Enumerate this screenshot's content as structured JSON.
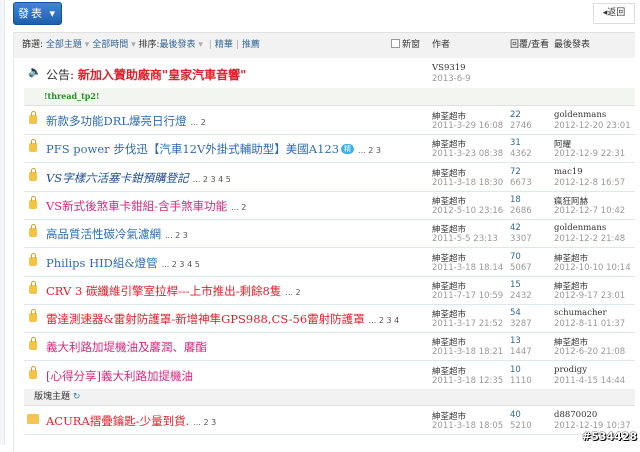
{
  "toolbar": {
    "post_label": "發表",
    "back_label": "返回"
  },
  "filter": {
    "label": "篩選:",
    "all_topics": "全部主題",
    "all_time": "全部時間",
    "sort_label": "排序:",
    "sort_value": "最後發表",
    "digest": "精華",
    "recommend": "推薦",
    "new_window": "新窗",
    "col_author": "作者",
    "col_replies": "回覆/查看",
    "col_last": "最後發表"
  },
  "announcement": {
    "prefix": "公告:",
    "title": "新加入贊助廠商\"皇家汽車音響\"",
    "author": "VS9319",
    "date": "2013-6-9"
  },
  "thread_tp": "!thread_tp2!",
  "threads": [
    {
      "title": "新款多功能DRL爆亮日行燈",
      "color": "blue",
      "pages": "... 2",
      "author": "紳荃超市",
      "date": "2011-3-29 16:08",
      "replies": "22",
      "views": "2746",
      "last_user": "goldenmans",
      "last_date": "2012-12-20 23:01"
    },
    {
      "title": "PFS power 步伐迅【汽車12V外掛式輔助型】美國A123",
      "color": "blue",
      "badge": "精",
      "pages": "... 2 3",
      "author": "紳荃超市",
      "date": "2011-3-23 08:38",
      "replies": "31",
      "views": "4362",
      "last_user": "阿耀",
      "last_date": "2012-12-9 22:31"
    },
    {
      "title": "VS字樣六活塞卡鉗預購登記",
      "color": "navy",
      "pages": "... 2 3 4 5",
      "author": "紳荃超市",
      "date": "2011-3-18 18:30",
      "replies": "72",
      "views": "6673",
      "last_user": "mac19",
      "last_date": "2012-12-8 16:57"
    },
    {
      "title": "VS新式後煞車卡鉗組-含手煞車功能",
      "color": "pink",
      "pages": "... 2",
      "author": "紳荃超市",
      "date": "2012-5-10 23:16",
      "replies": "18",
      "views": "2686",
      "last_user": "瘋狂阿赫",
      "last_date": "2012-12-7 10:42"
    },
    {
      "title": "高品質活性碳冷氣濾網",
      "color": "blue",
      "pages": "... 2 3",
      "author": "紳荃超市",
      "date": "2011-5-5 23:13",
      "replies": "42",
      "views": "3307",
      "last_user": "goldenmans",
      "last_date": "2012-12-2 21:48"
    },
    {
      "title": "Philips HID組&燈管",
      "color": "blue",
      "pages": "... 2 3 4 5",
      "author": "紳荃超市",
      "date": "2011-3-18 18:14",
      "replies": "70",
      "views": "5067",
      "last_user": "紳荃超市",
      "last_date": "2012-10-10 10:14"
    },
    {
      "title": "CRV 3 碳纖維引擎室拉桿---上市推出-剩餘8隻",
      "color": "red",
      "pages": "... 2",
      "author": "紳荃超市",
      "date": "2011-7-17 10:59",
      "replies": "15",
      "views": "2432",
      "last_user": "紳荃超市",
      "last_date": "2012-9-17 23:01"
    },
    {
      "title": "雷達測速器&雷射防護罩-新增神隼GPS988,CS-56雷射防護罩",
      "color": "red",
      "pages": "... 2 3 4",
      "author": "紳荃超市",
      "date": "2011-3-17 21:52",
      "replies": "54",
      "views": "3287",
      "last_user": "schumacher",
      "last_date": "2012-8-11 01:37"
    },
    {
      "title": "義大利路加堤機油及黁潤、黁酯",
      "color": "pink",
      "pages": "",
      "author": "紳荃超市",
      "date": "2011-3-18 18:21",
      "replies": "13",
      "views": "1447",
      "last_user": "紳荃超市",
      "last_date": "2012-6-20 21:08"
    },
    {
      "title": "[心得分享]義大利路加提機油",
      "color": "pink",
      "pages": "",
      "author": "紳荃超市",
      "date": "2011-3-18 12:35",
      "replies": "10",
      "views": "1110",
      "last_user": "prodigy",
      "last_date": "2011-4-15 14:44"
    }
  ],
  "board_section": {
    "label": "版塊主題"
  },
  "board_threads": [
    {
      "title": "ACURA摺疊鑰匙-少量到貨.",
      "color": "red",
      "pages": "... 2 3",
      "author": "紳荃超市",
      "date": "2011-3-18 18:05",
      "replies": "40",
      "views": "5210",
      "last_user": "d8870020",
      "last_date": "2012-12-19 10:37"
    }
  ],
  "watermark": "#534428"
}
